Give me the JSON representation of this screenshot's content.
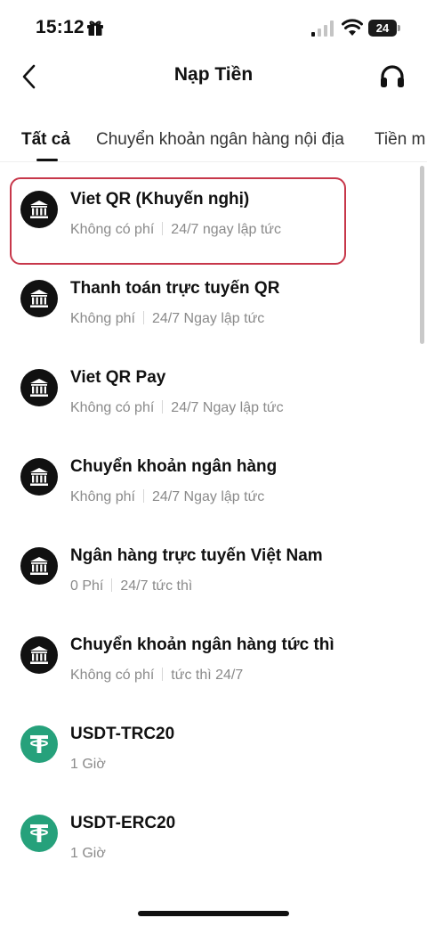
{
  "status_bar": {
    "time": "15:12",
    "battery": "24"
  },
  "header": {
    "title": "Nạp Tiền"
  },
  "tabs": [
    {
      "label": "Tất cả",
      "active": true
    },
    {
      "label": "Chuyển khoản ngân hàng nội địa",
      "active": false
    },
    {
      "label": "Tiền m",
      "active": false
    }
  ],
  "highlight_color": "#c7374a",
  "methods": [
    {
      "icon": "bank-icon",
      "title": "Viet QR (Khuyến nghị)",
      "fee": "Không có phí",
      "speed": "24/7 ngay lập tức"
    },
    {
      "icon": "bank-icon",
      "title": "Thanh toán trực tuyến QR",
      "fee": "Không phí",
      "speed": "24/7 Ngay lập tức"
    },
    {
      "icon": "bank-icon",
      "title": "Viet QR Pay",
      "fee": "Không có phí",
      "speed": "24/7 Ngay lập tức"
    },
    {
      "icon": "bank-icon",
      "title": "Chuyển khoản ngân hàng",
      "fee": "Không phí",
      "speed": "24/7 Ngay lập tức"
    },
    {
      "icon": "bank-icon",
      "title": "Ngân hàng trực tuyến Việt Nam",
      "fee": "0 Phí",
      "speed": "24/7 tức thì"
    },
    {
      "icon": "bank-icon",
      "title": "Chuyển khoản ngân hàng tức thì",
      "fee": "Không có phí",
      "speed": "tức thì 24/7"
    },
    {
      "icon": "tether-icon",
      "title": "USDT-TRC20",
      "fee": "1 Giờ"
    },
    {
      "icon": "tether-icon",
      "title": "USDT-ERC20",
      "fee": "1 Giờ"
    }
  ]
}
